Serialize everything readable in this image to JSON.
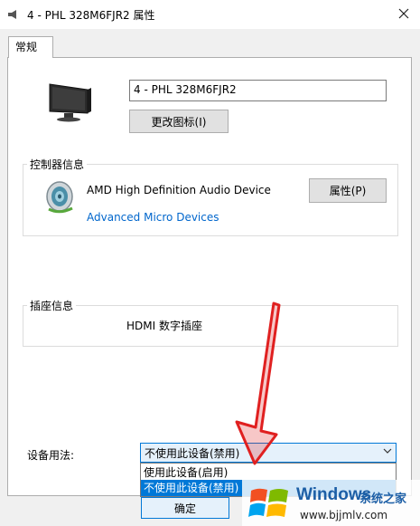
{
  "window": {
    "title": "4 - PHL 328M6FJR2 属性"
  },
  "tabs": [
    {
      "label": "常规"
    }
  ],
  "general": {
    "device_display_name": "4 - PHL 328M6FJR2",
    "change_icon_button": "更改图标(I)"
  },
  "controller": {
    "section_label": "控制器信息",
    "device_name": "AMD High Definition Audio Device",
    "properties_button": "属性(P)",
    "vendor_link": "Advanced Micro Devices"
  },
  "jack": {
    "section_label": "插座信息",
    "value": "HDMI 数字插座"
  },
  "device_usage": {
    "label": "设备用法:",
    "selected": "不使用此设备(禁用)",
    "options": [
      "使用此设备(启用)",
      "不使用此设备(禁用)"
    ],
    "highlighted_option_index": 1
  },
  "buttons": {
    "ok": "确定"
  },
  "watermark": {
    "brand": "Windows",
    "suffix": "系统之家",
    "url": "www.bjjmlv.com"
  },
  "annotation": {
    "arrow_color": "#e02020"
  },
  "colors": {
    "accent": "#0078d7",
    "link": "#0066cc"
  }
}
